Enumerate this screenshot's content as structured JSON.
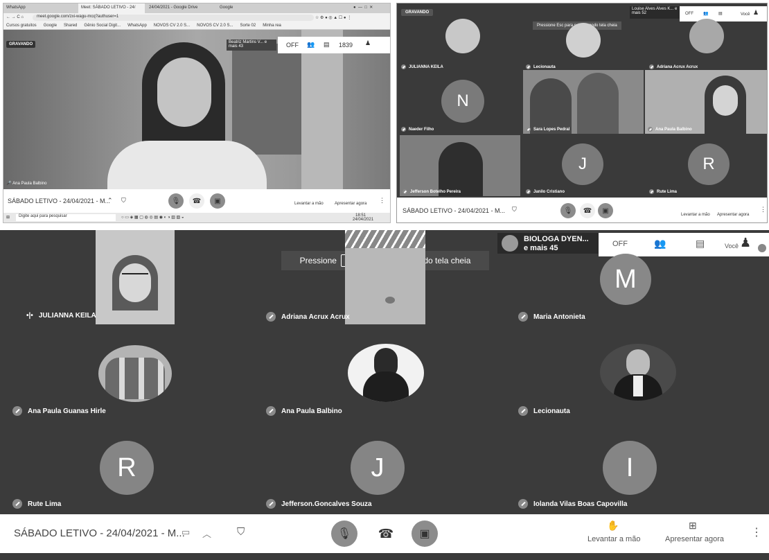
{
  "panel_a": {
    "browser_tabs": [
      "WhatsApp",
      "Meet: SÁBADO LETIVO - 24/",
      "24/04/2021 - Google Drive",
      "Google"
    ],
    "address": "meet.google.com/zxi-wagu-mcq?authuser=1",
    "bookmarks": [
      "Cursos gratuitos",
      "Google",
      "Shared",
      "Gênio Social Digit...",
      "WhatsApp",
      "NOVOS CV 2.0 S...",
      "NOVOS CV 2.0 S...",
      "Sorte 02",
      "Minha rea"
    ],
    "recording_label": "GRAVANDO",
    "host_overlay": "Beatriz Martins V... e mais 43",
    "off_label": "OFF",
    "counter": "1839",
    "presenter_name": "Ana Paula Balbino",
    "meeting_title": "SÁBADO LETIVO - 24/04/2021 - M...",
    "raise_hand": "Levantar a mão",
    "present_now": "Apresentar agora",
    "taskbar_search": "Digite aqui para pesquisar",
    "taskbar_time": "18:51",
    "taskbar_date": "24/04/2021"
  },
  "panel_b": {
    "recording_label": "GRAVANDO",
    "host_overlay": "Louise Alves Alves K... e mais 52",
    "esc_notice": "Pressione Esc para sair do modo tela cheia",
    "off_label": "OFF",
    "you_label": "Você",
    "participants": [
      {
        "name": "JULIANNA KEILA"
      },
      {
        "name": "Lecionauta"
      },
      {
        "name": "Adriana Acrux Acrux"
      },
      {
        "name": "Naeder Filho",
        "initial": "N"
      },
      {
        "name": "Sara Lopes Pedral"
      },
      {
        "name": "Ana Paula Balbino"
      },
      {
        "name": "Jefferson Botelho Pereira"
      },
      {
        "name": "Janilo Cristiano",
        "initial": "J"
      },
      {
        "name": "Rute Lima",
        "initial": "R"
      }
    ],
    "meeting_title": "SÁBADO LETIVO - 24/04/2021 - M...",
    "raise_hand": "Levantar a mão",
    "present_now": "Apresentar agora"
  },
  "panel_c": {
    "esc_notice_pre": "Pressione",
    "esc_key": "Esc",
    "esc_notice_post": "para sair do modo tela cheia",
    "host_name": "BIOLOGA DYEN...",
    "host_more": "e mais 45",
    "off_label": "OFF",
    "you_label": "Você",
    "participants": [
      {
        "name": "JULIANNA KEILA"
      },
      {
        "name": "Adriana Acrux Acrux"
      },
      {
        "name": "Maria Antonieta",
        "initial": "M"
      },
      {
        "name": "Ana Paula Guanas Hirle"
      },
      {
        "name": "Ana Paula Balbino"
      },
      {
        "name": "Lecionauta"
      },
      {
        "name": "Rute Lima",
        "initial": "R"
      },
      {
        "name": "Jefferson.Goncalves Souza",
        "initial": "J"
      },
      {
        "name": "Iolanda Vilas Boas Capovilla",
        "initial": "I"
      }
    ],
    "meeting_title": "SÁBADO LETIVO - 24/04/2021 - M...",
    "raise_hand": "Levantar a mão",
    "present_now": "Apresentar agora"
  }
}
